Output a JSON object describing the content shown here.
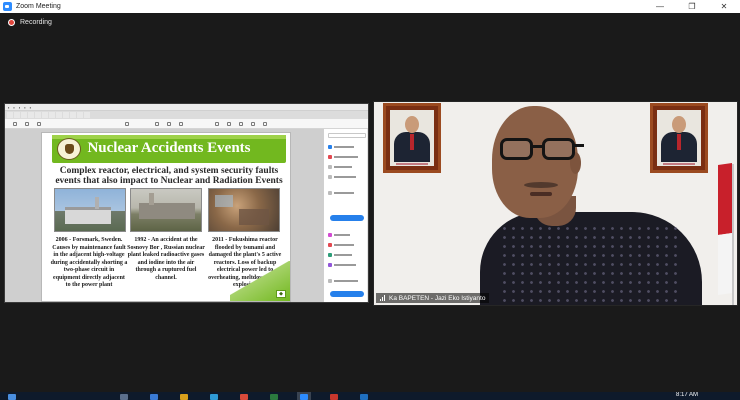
{
  "window": {
    "title": "Zoom Meeting",
    "icon": "zoom-icon",
    "controls": {
      "minimize": "—",
      "restore": "❐",
      "close": "✕"
    }
  },
  "recording": {
    "label": "Recording",
    "color": "#e0463c"
  },
  "shared_screen": {
    "slide": {
      "title": "Nuclear Accidents Events",
      "subtitle": "Complex reactor, electrical, and system security faults events that also impact to Nuclear and Radiation Events",
      "captions": [
        "2006 - Forsmark, Sweden. Causes by maintenance fault in the adjacent high-voltage during accidentally shorting a two-phase circuit in equipment directly adjacent to the power plant",
        "1992 - An accident at the Sosnovy Bor , Russian nuclear plant leaked radioactive gases and iodine into the air through a ruptured fuel channel.",
        "2011 - Fukushima reactor flooded by tsunami and damaged the plant's 5 active reactors. Loss of backup electrical power led to overheating, meltdowns, and explosion"
      ],
      "accent_color": "#72b81f"
    }
  },
  "video": {
    "participant_name": "Ka BAPETEN - Jazi Eko Istiyanto"
  },
  "taskbar": {
    "time": "8:17 AM"
  }
}
